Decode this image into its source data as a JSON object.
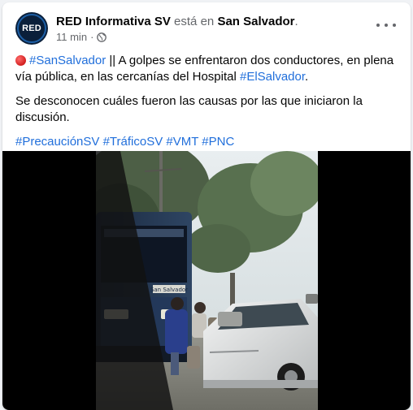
{
  "post": {
    "author": "RED Informativa SV",
    "verb": "está en",
    "place": "San Salvador",
    "place_suffix": ".",
    "time": "11 min",
    "separator": "·",
    "avatar_text": "RED",
    "privacy_icon": "globe-icon",
    "more_icon": "more-options-icon"
  },
  "content": {
    "p1": {
      "emoji": "red-circle-icon",
      "hashtag1": "#SanSalvador",
      "text1": " || A golpes se enfrentaron dos conductores, en plena vía pública, en las cercanías del Hospital ",
      "hashtag2": "#ElSalvador",
      "text2": "."
    },
    "p2": "Se desconocen cuáles fueron las causas por las que iniciaron la discusión.",
    "hashtags": [
      "#PrecauciónSV",
      "#TráficoSV",
      "#VMT",
      "#PNC"
    ]
  },
  "media": {
    "type": "video",
    "bus_sign": "San Salvador"
  },
  "colors": {
    "link": "#216fdb",
    "secondary_text": "#65676b",
    "avatar_bg": "#0a1f3a"
  }
}
